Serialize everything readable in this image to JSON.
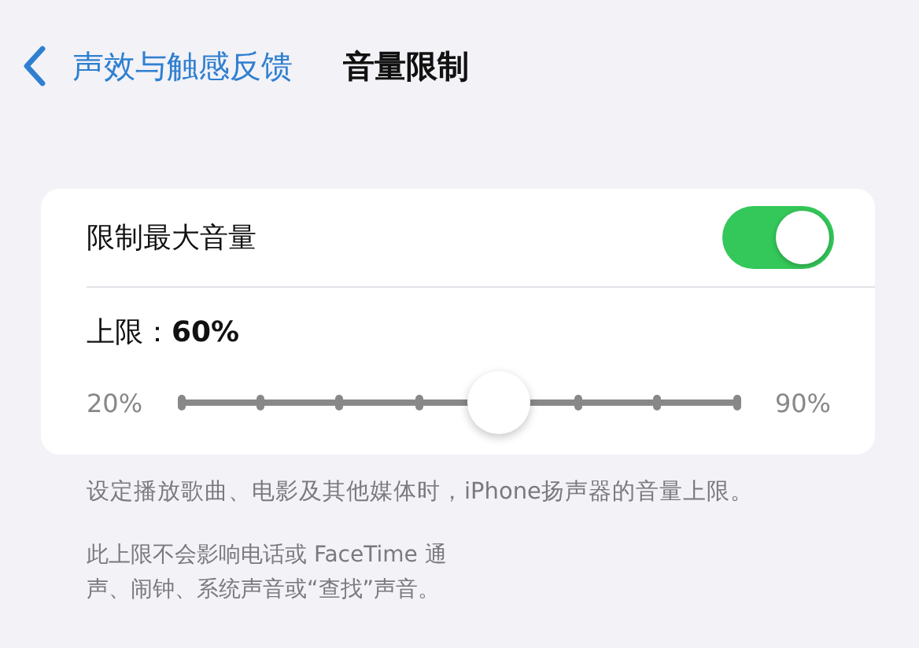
{
  "nav": {
    "back_label": "声效与触感反馈",
    "title": "音量限制"
  },
  "card": {
    "toggle": {
      "label": "限制最大音量",
      "on": true
    },
    "limit_label": "上限：",
    "limit_value": "60%",
    "slider": {
      "min_label": "20%",
      "max_label": "90%",
      "level": 0.571
    }
  },
  "footer_notes": [
    "设定播放歌曲、电影及其他媒体时，iPhone扬声器的音量上限。"
  ],
  "footer_lines": [
    "此上限不会影响电话或 FaceTime 通",
    "声、闹钟、系统声音或“查找”声音。"
  ]
}
